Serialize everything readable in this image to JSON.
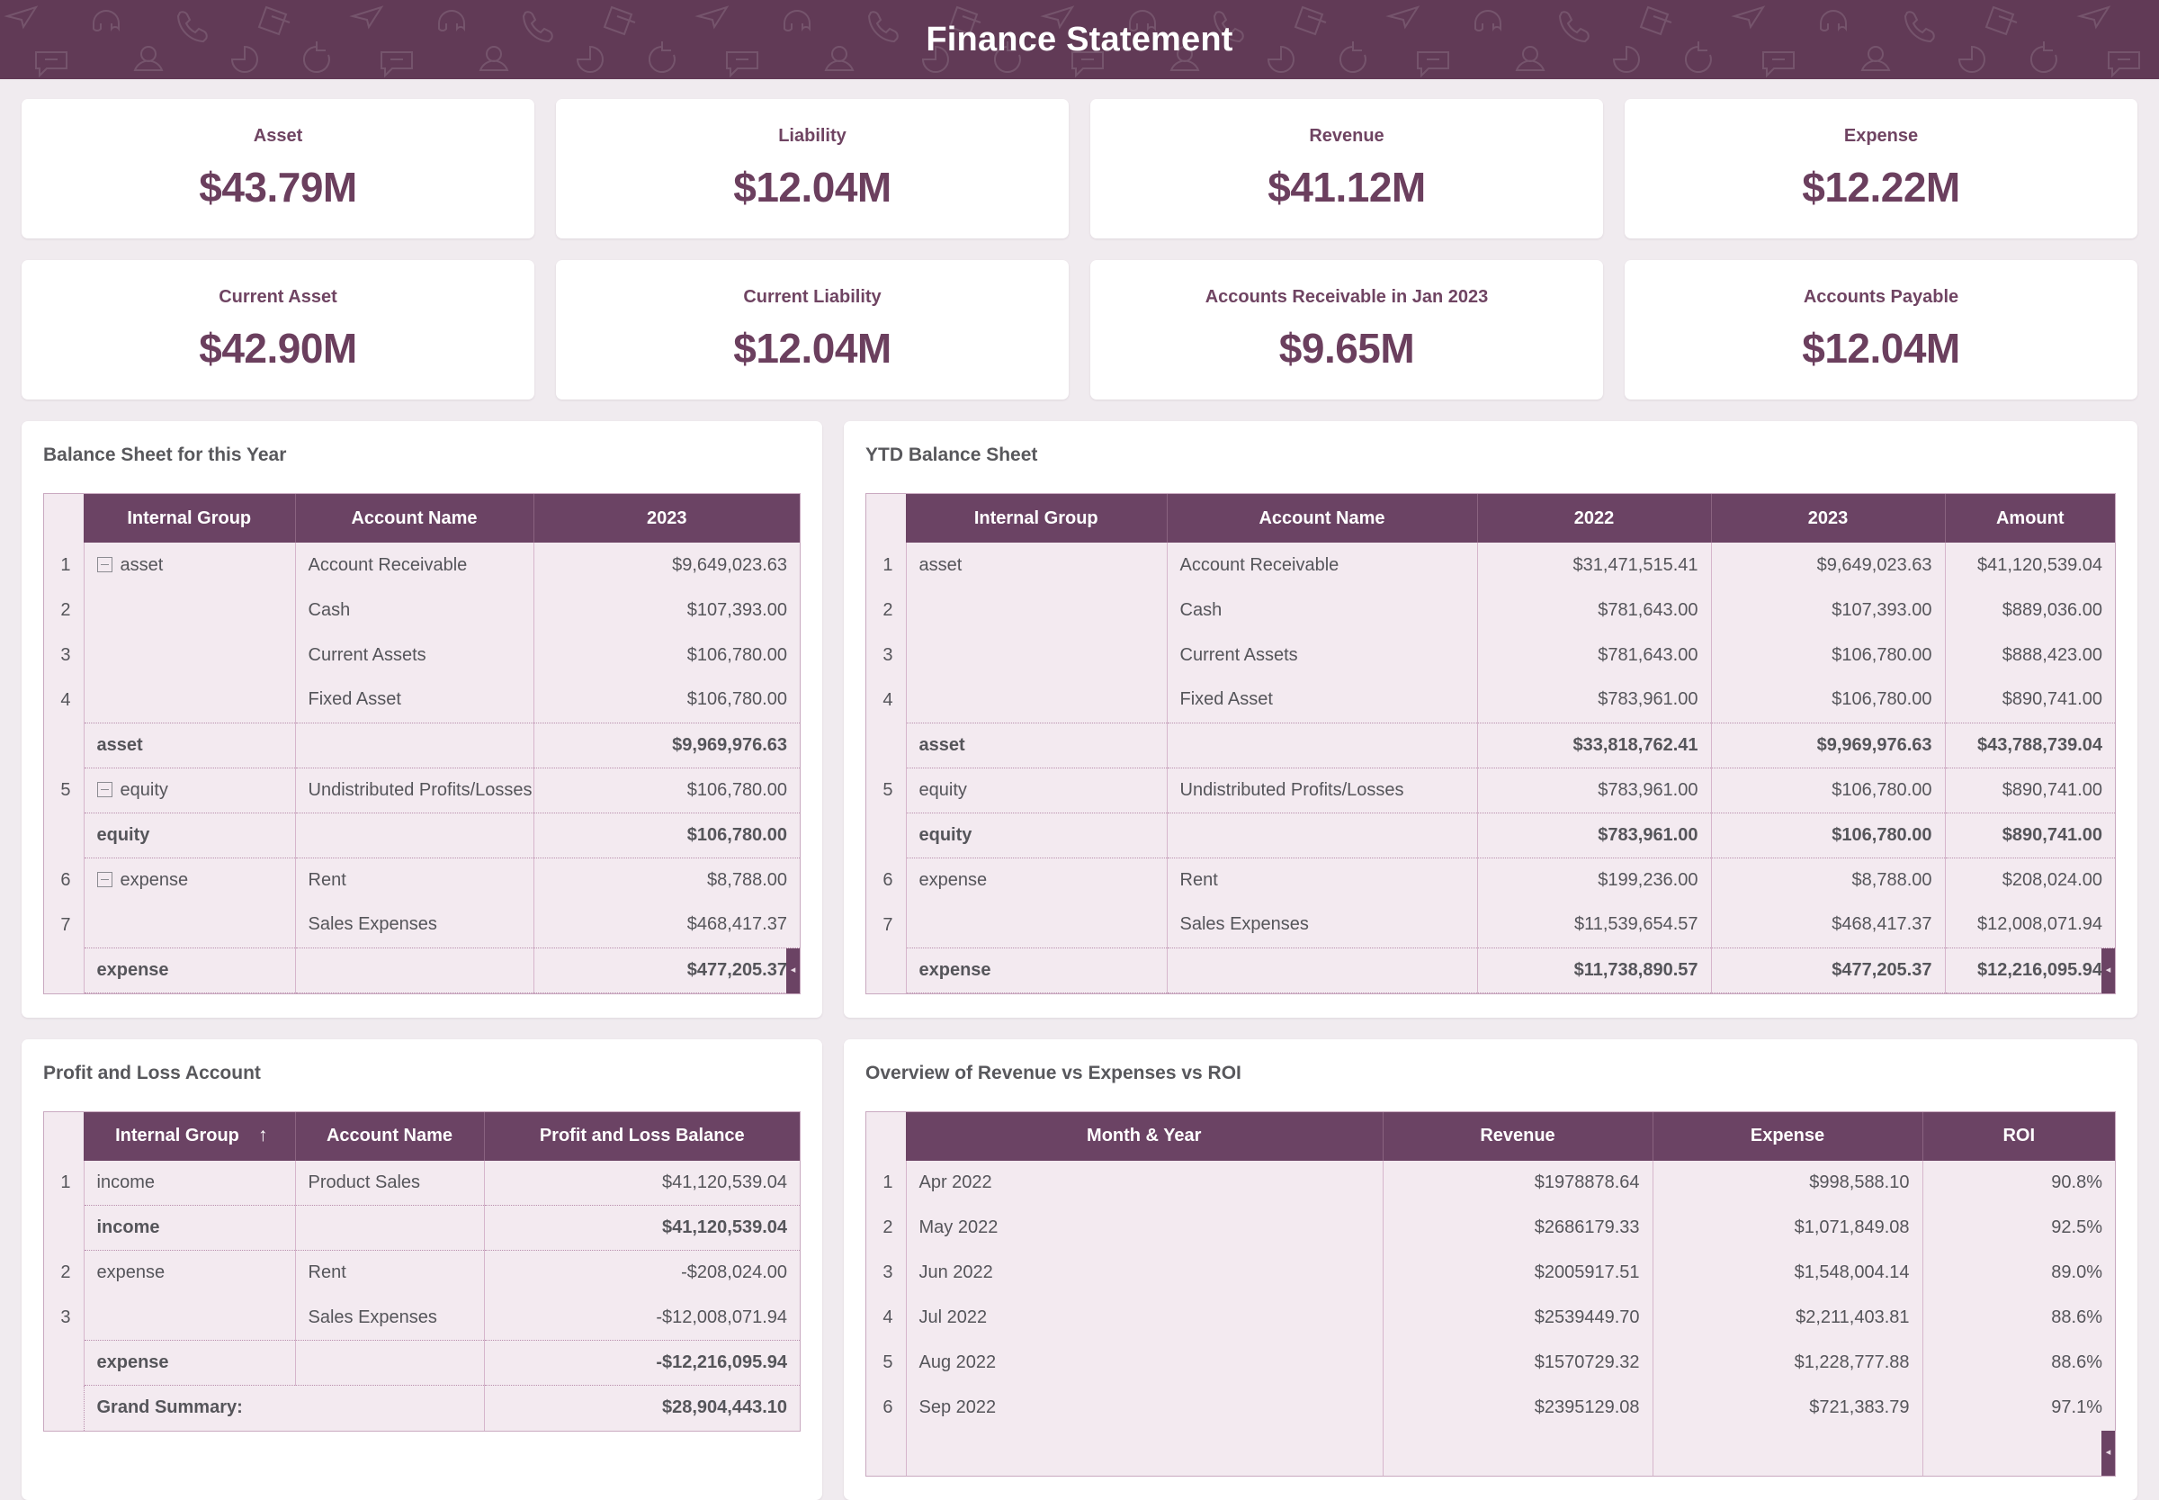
{
  "header": {
    "title": "Finance Statement",
    "pattern_icons": [
      "paper-plane-icon",
      "headphones-icon",
      "phone-ring-icon",
      "layers-icon",
      "chat-icon",
      "person-icon",
      "pie-chart-icon",
      "refresh-icon"
    ],
    "background_color": "#613a56"
  },
  "theme": {
    "page_background": "#f0ebef",
    "accent": "#6b4364",
    "card_background": "#ffffff",
    "grid_cell_background": "#f3eaf0",
    "kpi_text": "#6b3f5e"
  },
  "kpis": [
    {
      "title": "Asset",
      "value": "$43.79M"
    },
    {
      "title": "Liability",
      "value": "$12.04M"
    },
    {
      "title": "Revenue",
      "value": "$41.12M"
    },
    {
      "title": "Expense",
      "value": "$12.22M"
    },
    {
      "title": "Current Asset",
      "value": "$42.90M"
    },
    {
      "title": "Current Liability",
      "value": "$12.04M"
    },
    {
      "title": "Accounts Receivable in Jan 2023",
      "value": "$9.65M"
    },
    {
      "title": "Accounts Payable",
      "value": "$12.04M"
    }
  ],
  "balance_sheet": {
    "title": "Balance Sheet for this Year",
    "columns": [
      "Internal Group",
      "Account Name",
      "2023"
    ],
    "rows": [
      {
        "n": "1",
        "group": "asset",
        "toggle": true,
        "account": "Account Receivable",
        "v2023": "$9,649,023.63",
        "type": "data"
      },
      {
        "n": "2",
        "group": "",
        "toggle": false,
        "account": "Cash",
        "v2023": "$107,393.00",
        "type": "data"
      },
      {
        "n": "3",
        "group": "",
        "toggle": false,
        "account": "Current Assets",
        "v2023": "$106,780.00",
        "type": "data"
      },
      {
        "n": "4",
        "group": "",
        "toggle": false,
        "account": "Fixed Asset",
        "v2023": "$106,780.00",
        "type": "data"
      },
      {
        "n": "",
        "group": "asset",
        "toggle": false,
        "account": "",
        "v2023": "$9,969,976.63",
        "type": "subtotal"
      },
      {
        "n": "5",
        "group": "equity",
        "toggle": true,
        "account": "Undistributed Profits/Losses",
        "v2023": "$106,780.00",
        "type": "data"
      },
      {
        "n": "",
        "group": "equity",
        "toggle": false,
        "account": "",
        "v2023": "$106,780.00",
        "type": "subtotal"
      },
      {
        "n": "6",
        "group": "expense",
        "toggle": true,
        "account": "Rent",
        "v2023": "$8,788.00",
        "type": "data"
      },
      {
        "n": "7",
        "group": "",
        "toggle": false,
        "account": "Sales Expenses",
        "v2023": "$468,417.37",
        "type": "data"
      },
      {
        "n": "",
        "group": "expense",
        "toggle": false,
        "account": "",
        "v2023": "$477,205.37",
        "type": "subtotal"
      }
    ]
  },
  "ytd_balance_sheet": {
    "title": "YTD Balance Sheet",
    "columns": [
      "Internal Group",
      "Account Name",
      "2022",
      "2023",
      "Amount"
    ],
    "rows": [
      {
        "n": "1",
        "group": "asset",
        "account": "Account Receivable",
        "v2022": "$31,471,515.41",
        "v2023": "$9,649,023.63",
        "amount": "$41,120,539.04",
        "type": "data"
      },
      {
        "n": "2",
        "group": "",
        "account": "Cash",
        "v2022": "$781,643.00",
        "v2023": "$107,393.00",
        "amount": "$889,036.00",
        "type": "data"
      },
      {
        "n": "3",
        "group": "",
        "account": "Current Assets",
        "v2022": "$781,643.00",
        "v2023": "$106,780.00",
        "amount": "$888,423.00",
        "type": "data"
      },
      {
        "n": "4",
        "group": "",
        "account": "Fixed Asset",
        "v2022": "$783,961.00",
        "v2023": "$106,780.00",
        "amount": "$890,741.00",
        "type": "data"
      },
      {
        "n": "",
        "group": "asset",
        "account": "",
        "v2022": "$33,818,762.41",
        "v2023": "$9,969,976.63",
        "amount": "$43,788,739.04",
        "type": "subtotal"
      },
      {
        "n": "5",
        "group": "equity",
        "account": "Undistributed Profits/Losses",
        "v2022": "$783,961.00",
        "v2023": "$106,780.00",
        "amount": "$890,741.00",
        "type": "data"
      },
      {
        "n": "",
        "group": "equity",
        "account": "",
        "v2022": "$783,961.00",
        "v2023": "$106,780.00",
        "amount": "$890,741.00",
        "type": "subtotal"
      },
      {
        "n": "6",
        "group": "expense",
        "account": "Rent",
        "v2022": "$199,236.00",
        "v2023": "$8,788.00",
        "amount": "$208,024.00",
        "type": "data"
      },
      {
        "n": "7",
        "group": "",
        "account": "Sales Expenses",
        "v2022": "$11,539,654.57",
        "v2023": "$468,417.37",
        "amount": "$12,008,071.94",
        "type": "data"
      },
      {
        "n": "",
        "group": "expense",
        "account": "",
        "v2022": "$11,738,890.57",
        "v2023": "$477,205.37",
        "amount": "$12,216,095.94",
        "type": "subtotal"
      }
    ]
  },
  "profit_and_loss": {
    "title": "Profit and Loss Account",
    "columns": [
      "Internal Group",
      "Account Name",
      "Profit and Loss Balance"
    ],
    "sort_indicator": "↑",
    "rows": [
      {
        "n": "1",
        "group": "income",
        "account": "Product Sales",
        "balance": "$41,120,539.04",
        "type": "data"
      },
      {
        "n": "",
        "group": "income",
        "account": "",
        "balance": "$41,120,539.04",
        "type": "subtotal"
      },
      {
        "n": "2",
        "group": "expense",
        "account": "Rent",
        "balance": "-$208,024.00",
        "type": "data"
      },
      {
        "n": "3",
        "group": "",
        "account": "Sales Expenses",
        "balance": "-$12,008,071.94",
        "type": "data"
      },
      {
        "n": "",
        "group": "expense",
        "account": "",
        "balance": "-$12,216,095.94",
        "type": "subtotal"
      }
    ],
    "grand_summary_label": "Grand Summary:",
    "grand_summary_value": "$28,904,443.10"
  },
  "revenue_overview": {
    "title": "Overview of Revenue vs Expenses vs ROI",
    "columns": [
      "Month & Year",
      "Revenue",
      "Expense",
      "ROI"
    ],
    "rows": [
      {
        "n": "1",
        "month": "Apr 2022",
        "revenue": "$1978878.64",
        "expense": "$998,588.10",
        "roi": "90.8%"
      },
      {
        "n": "2",
        "month": "May 2022",
        "revenue": "$2686179.33",
        "expense": "$1,071,849.08",
        "roi": "92.5%"
      },
      {
        "n": "3",
        "month": "Jun 2022",
        "revenue": "$2005917.51",
        "expense": "$1,548,004.14",
        "roi": "89.0%"
      },
      {
        "n": "4",
        "month": "Jul 2022",
        "revenue": "$2539449.70",
        "expense": "$2,211,403.81",
        "roi": "88.6%"
      },
      {
        "n": "5",
        "month": "Aug 2022",
        "revenue": "$1570729.32",
        "expense": "$1,228,777.88",
        "roi": "88.6%"
      },
      {
        "n": "6",
        "month": "Sep 2022",
        "revenue": "$2395129.08",
        "expense": "$721,383.79",
        "roi": "97.1%"
      }
    ]
  }
}
